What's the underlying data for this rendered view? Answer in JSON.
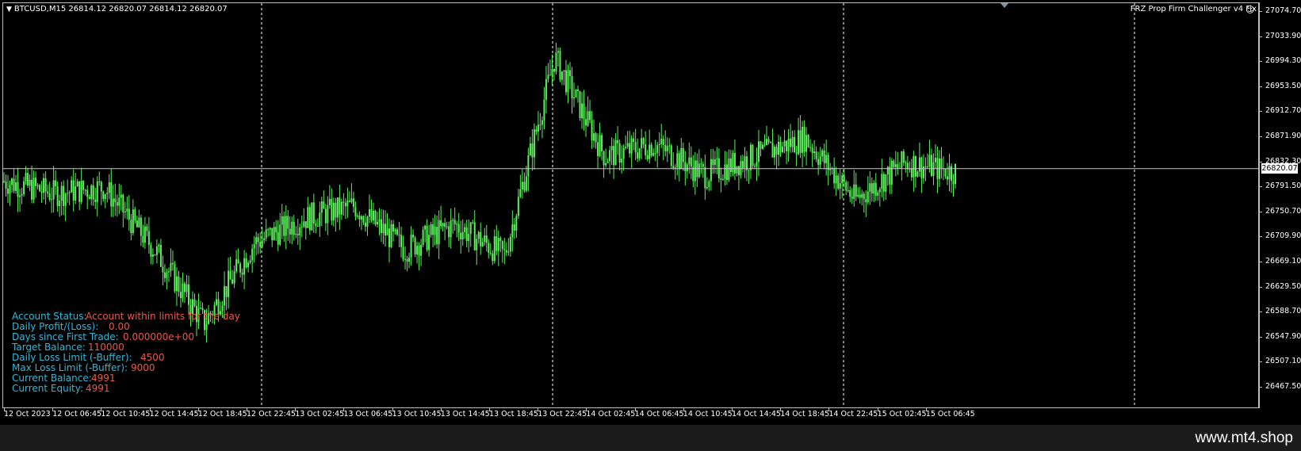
{
  "header": {
    "symbol_info": "BTCUSD,M15  26814.12 26820.07 26814.12 26820.07",
    "indicator_name": "FRZ Prop Firm Challenger v4 Fix",
    "smiley_icon": "smiley-face-icon",
    "menu_icon": "dropdown-triangle-icon"
  },
  "price_axis": {
    "labels": [
      "27074.70",
      "27033.90",
      "26994.30",
      "26953.50",
      "26912.70",
      "26871.90",
      "26832.30",
      "26791.50",
      "26750.70",
      "26709.90",
      "26669.10",
      "26629.50",
      "26588.70",
      "26547.90",
      "26507.10",
      "26467.50"
    ],
    "current_price": "26820.07"
  },
  "time_axis": {
    "labels": [
      "12 Oct 2023",
      "12 Oct 06:45",
      "12 Oct 10:45",
      "12 Oct 14:45",
      "12 Oct 18:45",
      "12 Oct 22:45",
      "13 Oct 02:45",
      "13 Oct 06:45",
      "13 Oct 10:45",
      "13 Oct 14:45",
      "13 Oct 18:45",
      "13 Oct 22:45",
      "14 Oct 02:45",
      "14 Oct 06:45",
      "14 Oct 10:45",
      "14 Oct 14:45",
      "14 Oct 18:45",
      "14 Oct 22:45",
      "15 Oct 02:45",
      "15 Oct 06:45"
    ]
  },
  "info_panel": [
    {
      "label": "Account Status:",
      "value": "Account within limits for the day"
    },
    {
      "label": "Daily Profit/(Loss):",
      "value": "0.00"
    },
    {
      "label": "Days since First Trade:",
      "value": "0.000000e+00"
    },
    {
      "label": "Target Balance:",
      "value": "110000"
    },
    {
      "label": "Daily Loss Limit (-Buffer):",
      "value": "4500"
    },
    {
      "label": "Max Loss Limit (-Buffer):",
      "value": "9000"
    },
    {
      "label": "Current Balance:",
      "value": "4991"
    },
    {
      "label": "Current Equity:",
      "value": "4991"
    }
  ],
  "watermark": "www.mt4.shop",
  "colors": {
    "background": "#000000",
    "candle": "#5cf05c",
    "price_line": "#c8c8c8",
    "separator": "#ffffff",
    "info_label": "#33b8d8",
    "info_value": "#e8594a"
  },
  "chart_data": {
    "type": "line",
    "symbol": "BTCUSD",
    "timeframe": "M15",
    "x": [
      "12 Oct 2023",
      "12 Oct 06:45",
      "12 Oct 10:45",
      "12 Oct 14:45",
      "12 Oct 18:45",
      "12 Oct 22:45",
      "13 Oct 02:45",
      "13 Oct 06:45",
      "13 Oct 10:45",
      "13 Oct 14:45",
      "13 Oct 18:45",
      "13 Oct 22:45",
      "14 Oct 02:45",
      "14 Oct 06:45",
      "14 Oct 10:45",
      "14 Oct 14:45",
      "14 Oct 18:45",
      "14 Oct 22:45",
      "15 Oct 02:45",
      "15 Oct 06:45"
    ],
    "series": [
      {
        "values": [
          26800,
          26780,
          26790,
          26690,
          26570,
          26700,
          26740,
          26760,
          26690,
          26730,
          26680,
          27000,
          26840,
          26860,
          26810,
          26840,
          26870,
          26770,
          26830,
          26815
        ]
      }
    ],
    "ylim": [
      26467.5,
      27074.7
    ],
    "current_price": 26820.07,
    "grid": false
  }
}
